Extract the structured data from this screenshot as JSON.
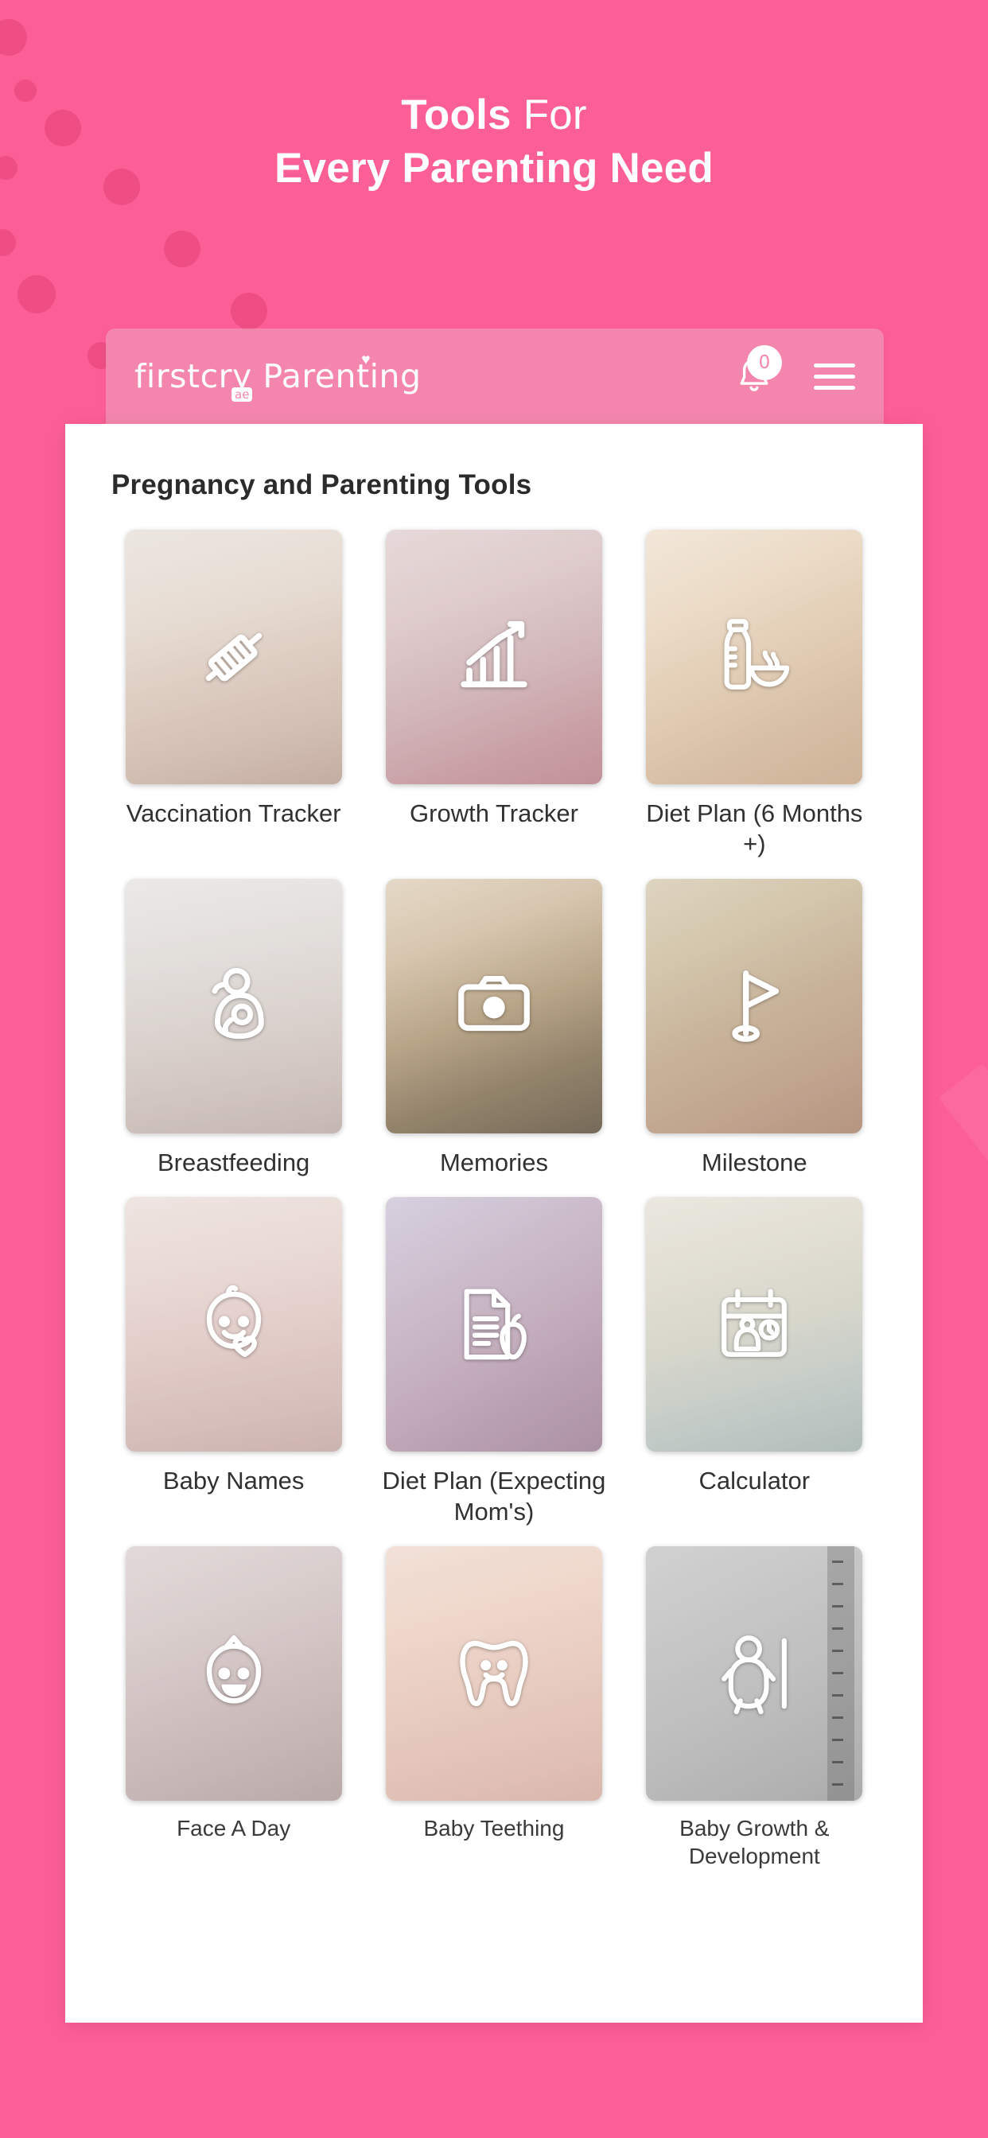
{
  "theme": {
    "background_pink": "#fc5f96",
    "header_bar_pink": "#f486ad",
    "panel_white": "#ffffff",
    "title_text": "#2b2b2b"
  },
  "hero": {
    "line1_strong": "Tools",
    "line1_light": " For",
    "line2": "Every Parenting Need"
  },
  "app_header": {
    "logo_first": "firstcry",
    "logo_second": "Parenting",
    "logo_badge": "ae",
    "heart_icon": "heart-icon",
    "notification_icon": "bell-icon",
    "notification_count": "0",
    "menu_icon": "hamburger-menu-icon"
  },
  "panel": {
    "title": "Pregnancy and Parenting Tools"
  },
  "tools": [
    {
      "label": "Vaccination Tracker",
      "icon": "syringe-icon",
      "photo": "ph-vacc"
    },
    {
      "label": "Growth Tracker",
      "icon": "growth-chart-icon",
      "photo": "ph-growth"
    },
    {
      "label": "Diet Plan (6 Months +)",
      "icon": "bottle-bowl-icon",
      "photo": "ph-diet6"
    },
    {
      "label": "Breastfeeding",
      "icon": "breastfeeding-icon",
      "photo": "ph-bf"
    },
    {
      "label": "Memories",
      "icon": "camera-icon",
      "photo": "ph-mem"
    },
    {
      "label": "Milestone",
      "icon": "flag-icon",
      "photo": "ph-miles"
    },
    {
      "label": "Baby Names",
      "icon": "baby-face-heart-icon",
      "photo": "ph-names"
    },
    {
      "label": "Diet Plan (Expecting Mom's)",
      "icon": "diet-document-icon",
      "photo": "ph-dietm"
    },
    {
      "label": "Calculator",
      "icon": "due-date-calendar-icon",
      "photo": "ph-calc"
    },
    {
      "label": "Face A Day",
      "icon": "baby-smile-icon",
      "photo": "ph-face"
    },
    {
      "label": "Baby Teething",
      "icon": "tooth-icon",
      "photo": "ph-teeth"
    },
    {
      "label": "Baby Growth & Development",
      "icon": "baby-height-icon",
      "photo": "ph-bgd"
    }
  ]
}
